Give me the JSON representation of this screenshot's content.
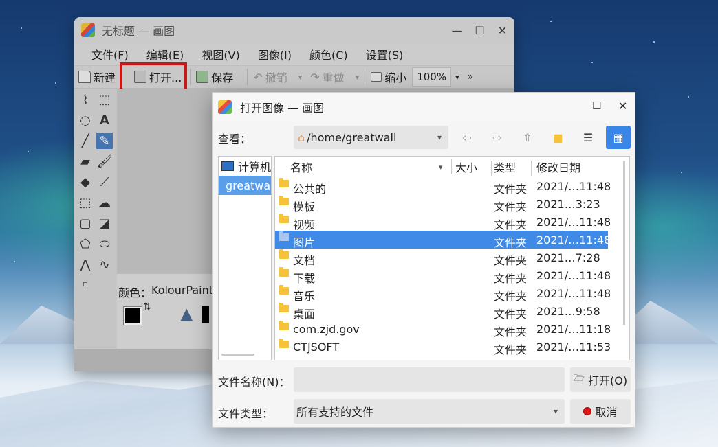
{
  "paint_window": {
    "title": "无标题 — 画图",
    "menu": [
      "文件(F)",
      "编辑(E)",
      "视图(V)",
      "图像(I)",
      "颜色(C)",
      "设置(S)"
    ],
    "toolbar": {
      "new": "新建",
      "open": "打开...",
      "save": "保存",
      "undo": "撤销",
      "redo": "重做",
      "zoom_out": "缩小",
      "zoom": "100%",
      "more": "»"
    },
    "color_label": "颜色：",
    "color_palette": "KolourPaint"
  },
  "dialog": {
    "title": "打开图像 — 画图",
    "look_in_label": "查看：",
    "path": "/home/greatwall",
    "sidebar": [
      {
        "label": "计算机",
        "selected": false
      },
      {
        "label": "greatwall",
        "selected": true
      }
    ],
    "columns": {
      "name": "名称",
      "size": "大小",
      "type": "类型",
      "date": "修改日期"
    },
    "files": [
      {
        "name": "公共的",
        "type": "文件夹",
        "date": "2021/…11:48"
      },
      {
        "name": "模板",
        "type": "文件夹",
        "date": "2021…3:23"
      },
      {
        "name": "视频",
        "type": "文件夹",
        "date": "2021/…11:48"
      },
      {
        "name": "图片",
        "type": "文件夹",
        "date": "2021/…11:48",
        "selected": true
      },
      {
        "name": "文档",
        "type": "文件夹",
        "date": "2021…7:28"
      },
      {
        "name": "下载",
        "type": "文件夹",
        "date": "2021/…11:48"
      },
      {
        "name": "音乐",
        "type": "文件夹",
        "date": "2021/…11:48"
      },
      {
        "name": "桌面",
        "type": "文件夹",
        "date": "2021…9:58"
      },
      {
        "name": "com.zjd.gov",
        "type": "文件夹",
        "date": "2021/…11:18"
      },
      {
        "name": "CTJSOFT",
        "type": "文件夹",
        "date": "2021/…11:53"
      }
    ],
    "filename_label": "文件名称(N)：",
    "filename_value": "",
    "open_button": "打开(O)",
    "filetype_label": "文件类型：",
    "filetype_value": "所有支持的文件",
    "cancel_button": "取消",
    "accent": "#3f8ae6"
  }
}
